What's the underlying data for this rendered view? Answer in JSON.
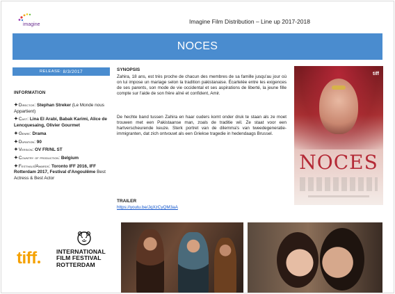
{
  "header": {
    "logo_text": "imagine",
    "title": "Imagine Film Distribution – Line up 2017-2018"
  },
  "film": {
    "title": "NOCES",
    "release_label": "Release:",
    "release_date": "8/3/2017"
  },
  "information": {
    "heading": "Information",
    "items": [
      {
        "key": "Director:",
        "value": "Stephan Streker",
        "extra": " (Le Monde nous Appartient)"
      },
      {
        "key": "Cast:",
        "value": "Lina El Arabi, Babak Karimi, Alice de Lencquesaing, Olivier Gourmet",
        "extra": ""
      },
      {
        "key": "Genre:",
        "value": "Drama",
        "extra": ""
      },
      {
        "key": "Duration:",
        "value": "90",
        "extra": ""
      },
      {
        "key": "Version:",
        "value": "OV FR/NL ST",
        "extra": ""
      },
      {
        "key": "Country of production:",
        "value": "Belgium",
        "extra": ""
      },
      {
        "key": "Festivals/Awards:",
        "value": "Toronto IFF 2016, IFF Rotterdam 2017, Festival d'Angoulême",
        "extra": " Best Actress & Best Actor"
      }
    ]
  },
  "synopsis": {
    "heading": "Synopsis",
    "fr": "Zahira, 18 ans, est très proche de chacun des membres de sa famille jusqu'au jour où on lui impose un mariage selon la tradition pakistanaise. Écartelée entre les exigences de ses parents, son mode de vie occidental et ses aspirations de liberté, la jeune fille compte sur l'aide de son frère aîné et confident, Amir.",
    "nl": "De hechte band tussen Zahira en haar ouders komt onder druk te staan als ze moet trouwen met een Pakistaanse man, zoals de traditie wil. Ze staat voor een hartverscheurende keuze. Sterk portret van de dilemma's van tweedegeneratie-immigranten, dat zich ontvouwt als een Griekse tragedie in hedendaags Brussel."
  },
  "trailer": {
    "heading": "Trailer",
    "url": "https://youtu.be/JqXzCyQM3aA"
  },
  "festival": {
    "mark": "tiff",
    "line1": "INTERNATIONAL",
    "line2": "FILM FESTIVAL",
    "line3": "ROTTERDAM"
  },
  "poster": {
    "badge": "tiff",
    "title": "NOCES"
  },
  "colors": {
    "accent": "#4a8ccf",
    "tiff_orange": "#f5a100",
    "link": "#1155cc"
  }
}
